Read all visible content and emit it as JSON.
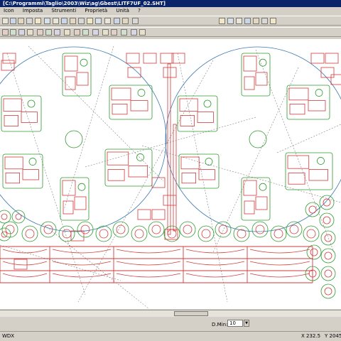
{
  "window": {
    "title": "[C:\\Programmi\\Taglio\\2003\\Wiz\\ag\\Gbest\\LITF7UF_02.SHT]"
  },
  "menu": {
    "items": [
      "Icon",
      "Imposta",
      "Strumenti",
      "Proprietà",
      "Unità",
      "?"
    ]
  },
  "options": {
    "label": "D.Min:",
    "value": "10"
  },
  "status": {
    "left": "WDX",
    "x": "X 232.5",
    "y": "Y 2045"
  },
  "icons": {
    "toolbar1": [
      "new-icon",
      "open-icon",
      "save-icon",
      "print-icon",
      "cut-icon",
      "copy-icon",
      "paste-icon",
      "undo-icon",
      "select-icon",
      "move-icon",
      "rotate-icon",
      "mirror-icon",
      "text-icon",
      "measure-icon",
      "grid-icon",
      "layer-icon",
      "zoom-in-icon",
      "zoom-out-icon",
      "zoom-window-icon",
      "zoom-all-icon",
      "pan-icon",
      "refresh-icon",
      "help-icon"
    ],
    "toolbar2": [
      "draw-line-icon",
      "draw-arc-icon",
      "draw-circle-icon",
      "draw-rect-icon",
      "node-icon",
      "trim-icon",
      "extend-icon",
      "offset-icon",
      "nest-icon",
      "path-icon",
      "cut-order-icon",
      "lead-in-icon",
      "bridge-icon",
      "simulate-icon",
      "export-icon",
      "delete-icon"
    ]
  },
  "colors": {
    "titlebar": "#0a246a",
    "part_outline": "#d03b3b",
    "nesting_outline": "#2e9a2e",
    "rapid_path": "#808080",
    "sheet_circle": "#3b78b0"
  }
}
